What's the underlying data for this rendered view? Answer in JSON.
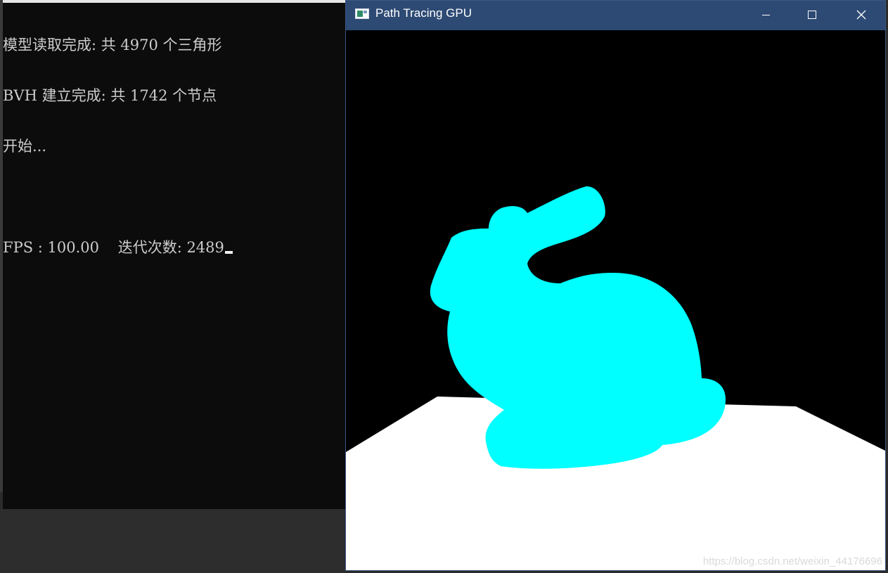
{
  "console": {
    "lines": [
      "模型读取完成: 共 4970 个三角形",
      "BVH 建立完成: 共 1742 个节点",
      "开始...",
      "",
      "FPS : 100.00    迭代次数: 2489"
    ]
  },
  "render_window": {
    "title": "Path Tracing GPU",
    "icons": {
      "app": "app-window-icon",
      "minimize": "minimize-icon",
      "maximize": "maximize-icon",
      "close": "close-icon"
    },
    "scene": {
      "background": "#000000",
      "floor_color": "#ffffff",
      "model_color": "#00ffff"
    },
    "watermark": "https://blog.csdn.net/weixin_44176696"
  }
}
